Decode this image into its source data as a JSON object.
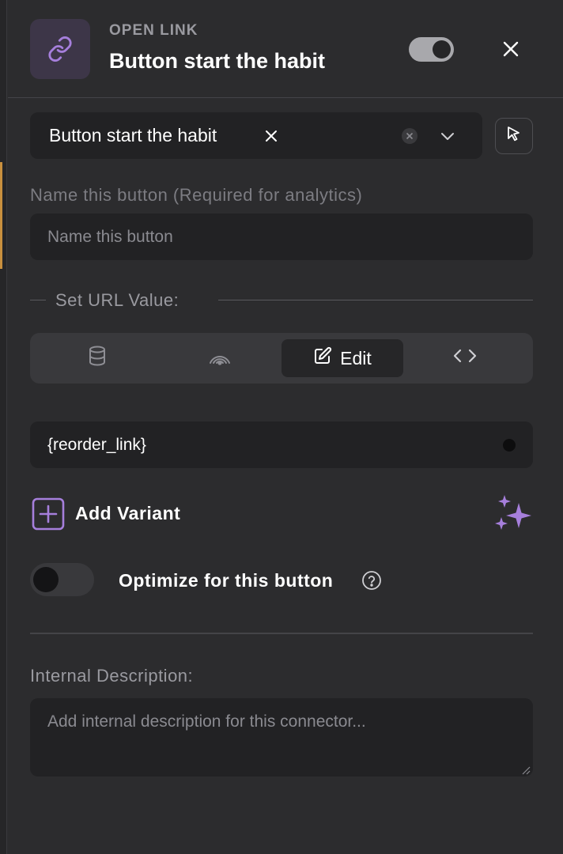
{
  "header": {
    "kicker": "OPEN LINK",
    "title": "Button start the habit",
    "icon": "link-icon",
    "toggle_on": true,
    "close_icon": "close-icon"
  },
  "selector": {
    "selected_label": "Button start the habit",
    "icons": [
      "remove-chip-icon",
      "clear-icon",
      "chevron-down-icon",
      "cursor-pointer-icon"
    ]
  },
  "name_field": {
    "label": "Name this button (Required for analytics)",
    "placeholder": "Name this button",
    "value": ""
  },
  "url_section": {
    "label": "Set URL Value:",
    "tabs": [
      {
        "icon": "database-icon",
        "label": ""
      },
      {
        "icon": "broadcast-icon",
        "label": ""
      },
      {
        "icon": "edit-icon",
        "label": "Edit",
        "active": true
      },
      {
        "icon": "code-icon",
        "label": ""
      }
    ],
    "value": "{reorder_link}"
  },
  "variant": {
    "label": "Add Variant",
    "icon": "plus-square-icon",
    "ai_icon": "sparkle-icon"
  },
  "optimize": {
    "label": "Optimize for this button",
    "enabled": false,
    "help_icon": "help-circle-icon"
  },
  "description": {
    "label": "Internal Description:",
    "placeholder": "Add internal description for this connector...",
    "value": ""
  },
  "colors": {
    "background": "#2c2c2e",
    "field": "#222224",
    "accent": "#a67fdc",
    "sidebar_accent": "#c9903e"
  }
}
